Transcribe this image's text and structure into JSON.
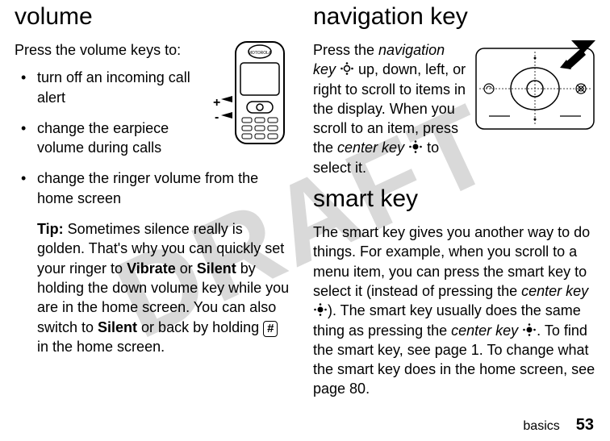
{
  "watermark": "DRAFT",
  "left": {
    "heading": "volume",
    "intro": "Press the volume keys to:",
    "items": {
      "li1": "turn off an incoming call alert",
      "li2": "change the earpiece volume during calls",
      "li3": "change the ringer volume from the home screen"
    },
    "tip_label": "Tip:",
    "tip_a": " Sometimes silence really is golden. That's why you can quickly set your ringer to ",
    "vibrate": "Vibrate",
    "tip_b": " or ",
    "silent": "Silent",
    "tip_c": " by holding the down volume key while you are in the home screen. You can also switch to ",
    "tip_d": " or back by holding ",
    "hashkey": "#",
    "tip_e": " in the home screen."
  },
  "right": {
    "heading1": "navigation key",
    "nav_a": "Press the ",
    "navkey_label": "navigation key",
    "nav_b": " up, down, left, or right to scroll to items in the display. When you scroll to an item, press the ",
    "centerkey_label": "center key",
    "nav_c": " to select it.",
    "heading2": "smart key",
    "smart_a": "The smart key gives you another way to do things. For example, when you scroll to a menu item, you can press the smart key to select it (instead of pressing the ",
    "smart_b": "). The smart key usually does the same thing as pressing the ",
    "smart_c": ". To find the smart key, see page 1. To change what the smart key does in the home screen, see page 80."
  },
  "footer": {
    "label": "basics",
    "page": "53"
  },
  "icons": {
    "phone": "phone-illustration",
    "navpad": "navigation-pad-illustration",
    "navdot_open": "nav-key-icon",
    "navdot_solid": "center-key-icon"
  }
}
